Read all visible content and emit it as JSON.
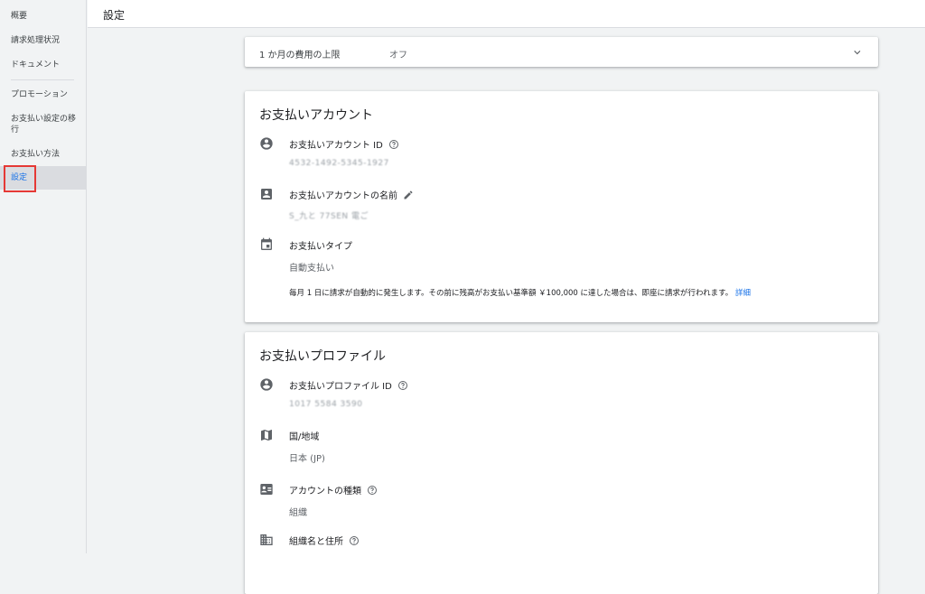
{
  "sidebar": {
    "items": [
      {
        "label": "概要"
      },
      {
        "label": "請求処理状況"
      },
      {
        "label": "ドキュメント"
      },
      {
        "label": "プロモーション"
      },
      {
        "label": "お支払い設定の移行"
      },
      {
        "label": "お支払い方法"
      },
      {
        "label": "設定"
      }
    ]
  },
  "header": {
    "title": "設定"
  },
  "budget": {
    "label": "1 か月の費用の上限",
    "value": "オフ"
  },
  "account": {
    "title": "お支払いアカウント",
    "id_label": "お支払いアカウント ID",
    "id_value": "4532-1492-5345-1927",
    "name_label": "お支払いアカウントの名前",
    "name_value": "S_九と 77SEN 電ご",
    "type_label": "お支払いタイプ",
    "type_value": "自動支払い",
    "description": "毎月 1 日に請求が自動的に発生します。その前に残高がお支払い基準額 ￥100,000 に達した場合は、即座に請求が行われます。",
    "learn_more": "詳細"
  },
  "profile": {
    "title": "お支払いプロファイル",
    "id_label": "お支払いプロファイル ID",
    "id_value": "1017 5584 3590",
    "country_label": "国/地域",
    "country_value": "日本 (JP)",
    "acctype_label": "アカウントの種類",
    "acctype_value": "組織",
    "org_label": "組織名と住所"
  },
  "colors": {
    "accent": "#1a73e8",
    "highlight": "#e53935",
    "icon": "#5f6368"
  }
}
